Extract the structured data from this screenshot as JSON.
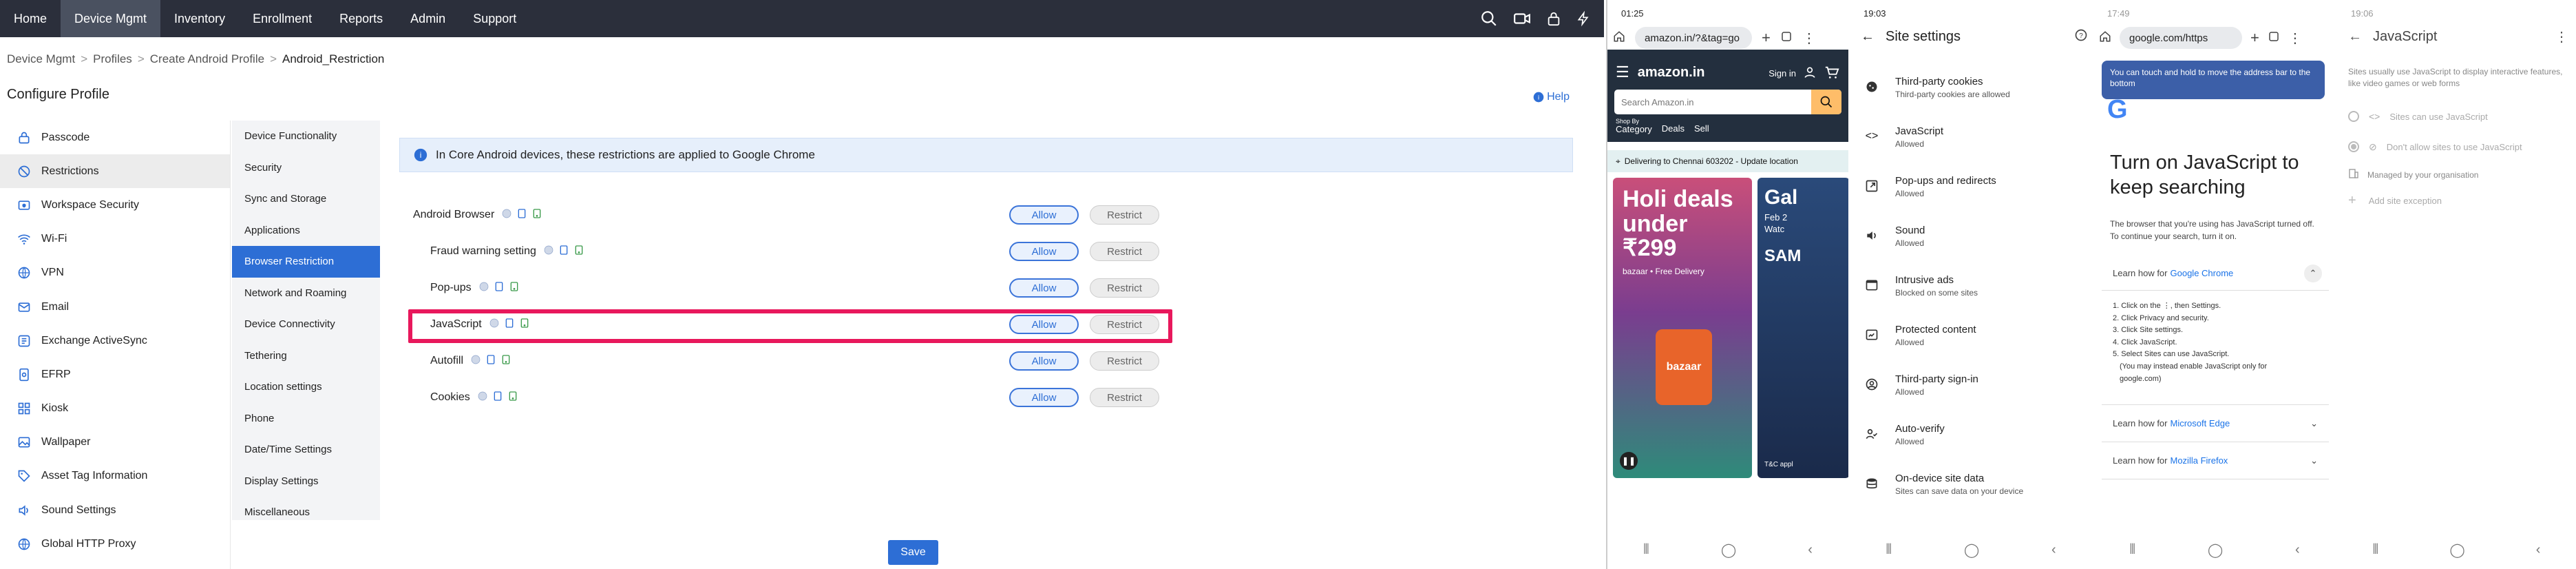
{
  "topnav": {
    "items": [
      "Home",
      "Device Mgmt",
      "Inventory",
      "Enrollment",
      "Reports",
      "Admin",
      "Support"
    ],
    "active": "Device Mgmt"
  },
  "breadcrumb": [
    "Device Mgmt",
    "Profiles",
    "Create Android Profile",
    "Android_Restriction"
  ],
  "page_title": "Configure Profile",
  "profile_menu": [
    {
      "label": "Passcode",
      "icon": "passcode-icon"
    },
    {
      "label": "Restrictions",
      "icon": "restrictions-icon",
      "active": true
    },
    {
      "label": "Workspace Security",
      "icon": "workspace-security-icon"
    },
    {
      "label": "Wi-Fi",
      "icon": "wifi-icon"
    },
    {
      "label": "VPN",
      "icon": "vpn-icon"
    },
    {
      "label": "Email",
      "icon": "email-icon"
    },
    {
      "label": "Exchange ActiveSync",
      "icon": "exchange-icon"
    },
    {
      "label": "EFRP",
      "icon": "efrp-icon"
    },
    {
      "label": "Kiosk",
      "icon": "kiosk-icon"
    },
    {
      "label": "Wallpaper",
      "icon": "wallpaper-icon"
    },
    {
      "label": "Asset Tag Information",
      "icon": "asset-tag-icon"
    },
    {
      "label": "Sound Settings",
      "icon": "sound-icon"
    },
    {
      "label": "Global HTTP Proxy",
      "icon": "globe-icon"
    }
  ],
  "category_menu": [
    "Device Functionality",
    "Security",
    "Sync and Storage",
    "Applications",
    "Browser Restriction",
    "Network and Roaming",
    "Device Connectivity",
    "Tethering",
    "Location settings",
    "Phone",
    "Date/Time Settings",
    "Display Settings",
    "Miscellaneous"
  ],
  "active_category": "Browser Restriction",
  "help_label": "Help",
  "info_banner": "In Core Android devices, these restrictions are applied to Google Chrome",
  "restrictions": [
    {
      "label": "Android Browser",
      "allow": "Allow",
      "restrict": "Restrict"
    },
    {
      "label": "Fraud warning setting",
      "allow": "Allow",
      "restrict": "Restrict"
    },
    {
      "label": "Pop-ups",
      "allow": "Allow",
      "restrict": "Restrict"
    },
    {
      "label": "JavaScript",
      "allow": "Allow",
      "restrict": "Restrict"
    },
    {
      "label": "Autofill",
      "allow": "Allow",
      "restrict": "Restrict"
    },
    {
      "label": "Cookies",
      "allow": "Allow",
      "restrict": "Restrict"
    }
  ],
  "save_label": "Save",
  "phone1": {
    "time": "01:25",
    "url": "amazon.in/?&tag=go",
    "logo": "amazon.in",
    "signin": "Sign in",
    "search_placeholder": "Search Amazon.in",
    "shop_by": "Shop By",
    "category": "Category",
    "deals": "Deals",
    "sell": "Sell",
    "delivery": "Delivering to Chennai 603202 - Update location",
    "banner1_title": "Holi deals under ₹299",
    "banner1_sub": "bazaar • Free Delivery",
    "banner1_brand": "bazaar",
    "banner2_title": "Gal",
    "banner2_sub": "Feb 2",
    "banner2_sub2": "Watc",
    "banner2_brand": "SAM",
    "banner2_tc": "T&C appl"
  },
  "phone2": {
    "time": "19:03",
    "title": "Site settings",
    "items": [
      {
        "title": "Third-party cookies",
        "sub": "Third-party cookies are allowed",
        "icon": "cookie-icon"
      },
      {
        "title": "JavaScript",
        "sub": "Allowed",
        "icon": "code-icon"
      },
      {
        "title": "Pop-ups and redirects",
        "sub": "Allowed",
        "icon": "popup-icon"
      },
      {
        "title": "Sound",
        "sub": "Allowed",
        "icon": "sound-icon"
      },
      {
        "title": "Intrusive ads",
        "sub": "Blocked on some sites",
        "icon": "ads-icon"
      },
      {
        "title": "Protected content",
        "sub": "Allowed",
        "icon": "protected-content-icon"
      },
      {
        "title": "Third-party sign-in",
        "sub": "Allowed",
        "icon": "account-icon"
      },
      {
        "title": "Auto-verify",
        "sub": "Allowed",
        "icon": "auto-verify-icon"
      },
      {
        "title": "On-device site data",
        "sub": "Sites can save data on your device",
        "icon": "storage-icon"
      }
    ]
  },
  "phone3": {
    "time": "17:49",
    "url": "google.com/https",
    "tooltip": "You can touch and hold to move the address bar to the bottom",
    "heading": "Turn on JavaScript to keep searching",
    "desc": "The browser that you're using has JavaScript turned off. To continue your search, turn it on.",
    "learn1": "Learn how for",
    "learn1_link": "Google Chrome",
    "steps": [
      "1. Click on the ⋮, then Settings.",
      "2. Click Privacy and security.",
      "3. Click Site settings.",
      "4. Click JavaScript.",
      "5. Select Sites can use JavaScript."
    ],
    "steps_note": "(You may instead enable JavaScript only for google.com)",
    "learn2": "Learn how for",
    "learn2_link": "Microsoft Edge",
    "learn3": "Learn how for",
    "learn3_link": "Mozilla Firefox"
  },
  "phone4": {
    "time": "19:06",
    "title": "JavaScript",
    "desc": "Sites usually use JavaScript to display interactive features, like video games or web forms",
    "option1": "Sites can use JavaScript",
    "option2": "Don't allow sites to use JavaScript",
    "managed": "Managed by your organisation",
    "add_exception": "Add site exception"
  }
}
